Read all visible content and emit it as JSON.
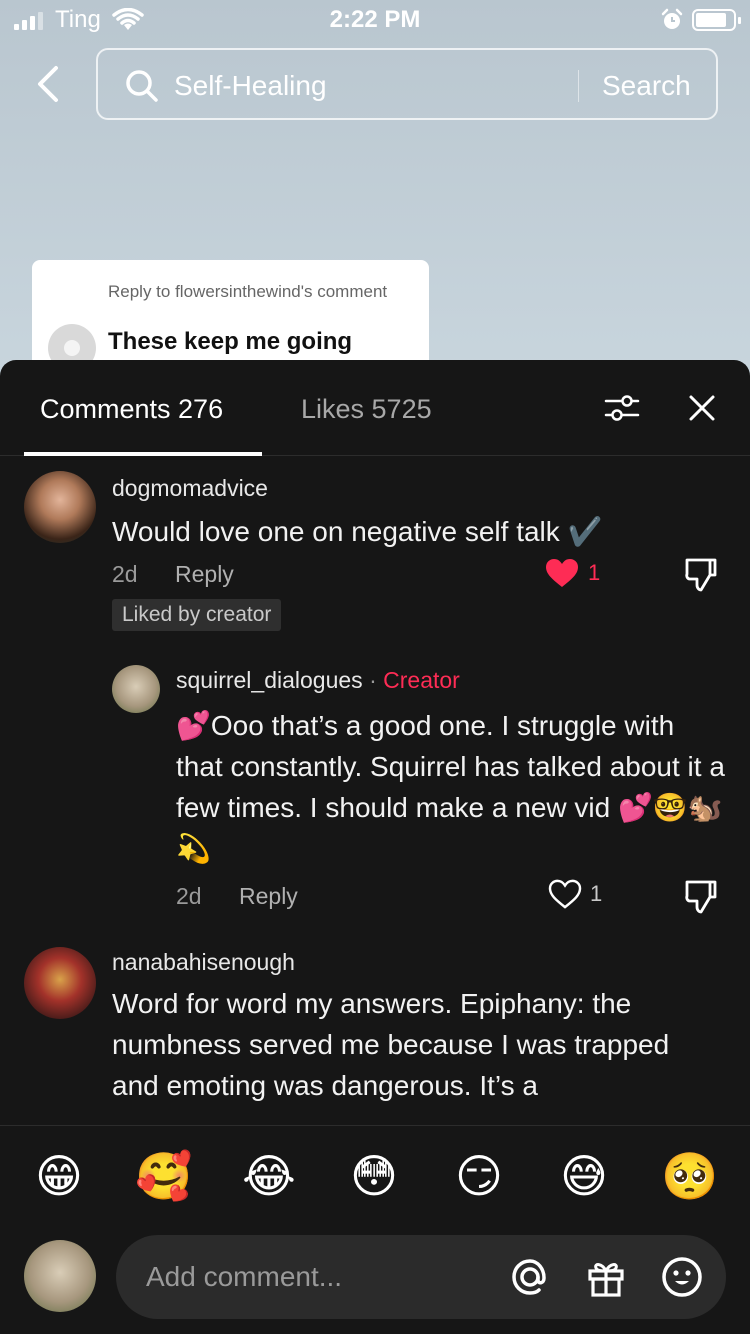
{
  "status_bar": {
    "carrier": "Ting",
    "time": "2:22 PM"
  },
  "search": {
    "query": "Self-Healing",
    "button_label": "Search"
  },
  "reply_sticker": {
    "header": "Reply to flowersinthewind's comment",
    "text": "These keep me going"
  },
  "tabs": {
    "comments_label": "Comments 276",
    "likes_label": "Likes 5725"
  },
  "comments": [
    {
      "username": "dogmomadvice",
      "text": "Would love one on negative self talk ✔️",
      "age": "2d",
      "reply_label": "Reply",
      "like_count": "1",
      "liked": true,
      "badge": "Liked by creator",
      "replies": [
        {
          "username": "squirrel_dialogues",
          "creator_tag": "Creator",
          "text": "💕Ooo that’s a good one. I struggle with that constantly. Squirrel has talked about it a few times. I should make a new vid 💕🤓🐿️💫",
          "age": "2d",
          "reply_label": "Reply",
          "like_count": "1",
          "liked": false
        }
      ]
    },
    {
      "username": "nanabahisenough",
      "text": "Word for word my answers. Epiphany: the numbness served me because I was trapped and emoting was dangerous. It’s a"
    }
  ],
  "emoji_bar": [
    "😁",
    "🥰",
    "😂",
    "😳",
    "😏",
    "😅",
    "🥺"
  ],
  "input": {
    "placeholder": "Add comment..."
  },
  "colors": {
    "panel_bg": "#161616",
    "accent_red": "#fe2c55",
    "input_bg": "#2b2b2b"
  }
}
